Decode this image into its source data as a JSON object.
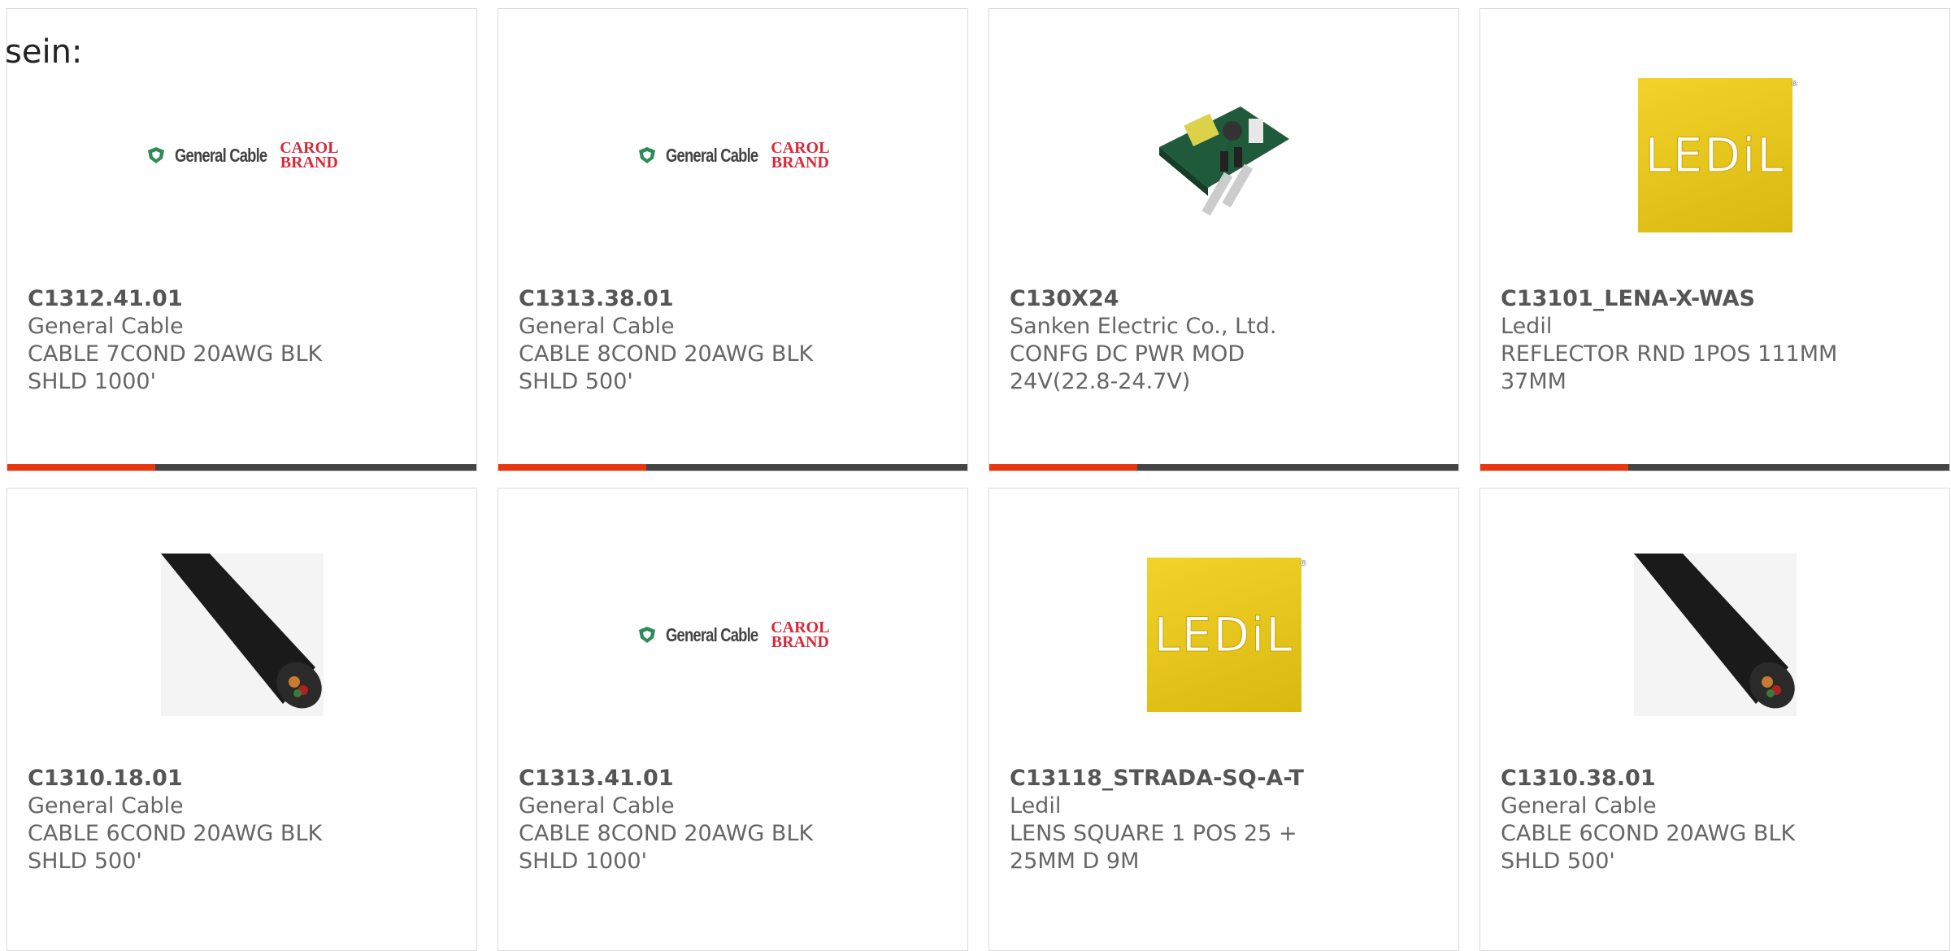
{
  "intro_text": "sein:",
  "products": [
    {
      "part": "C1312.41.01",
      "manufacturer": "General Cable",
      "description": "CABLE 7COND 20AWG BLK SHLD 1000'",
      "image": "general-cable-logo"
    },
    {
      "part": "C1313.38.01",
      "manufacturer": "General Cable",
      "description": "CABLE 8COND 20AWG BLK SHLD 500'",
      "image": "general-cable-logo"
    },
    {
      "part": "C130X24",
      "manufacturer": "Sanken Electric Co., Ltd.",
      "description": "CONFG DC PWR MOD 24V(22.8-24.7V)",
      "image": "power-module-photo"
    },
    {
      "part": "C13101_LENA-X-WAS",
      "manufacturer": "Ledil",
      "description": "REFLECTOR RND 1POS 111MM 37MM",
      "image": "ledil-logo"
    },
    {
      "part": "C1310.18.01",
      "manufacturer": "General Cable",
      "description": "CABLE 6COND 20AWG BLK SHLD 500'",
      "image": "cable-photo"
    },
    {
      "part": "C1313.41.01",
      "manufacturer": "General Cable",
      "description": "CABLE 8COND 20AWG BLK SHLD 1000'",
      "image": "general-cable-logo"
    },
    {
      "part": "C13118_STRADA-SQ-A-T",
      "manufacturer": "Ledil",
      "description": "LENS SQUARE 1 POS 25 + 25MM D 9M",
      "image": "ledil-logo"
    },
    {
      "part": "C1310.38.01",
      "manufacturer": "General Cable",
      "description": "CABLE 6COND 20AWG BLK SHLD 500'",
      "image": "cable-photo"
    }
  ],
  "logos": {
    "general_cable": "General Cable",
    "carol_top": "CAROL",
    "carol_bottom": "BRAND",
    "ledil": "LEDiL"
  },
  "colors": {
    "accent": "#e8360f",
    "bar": "#444444",
    "text": "#666666"
  }
}
